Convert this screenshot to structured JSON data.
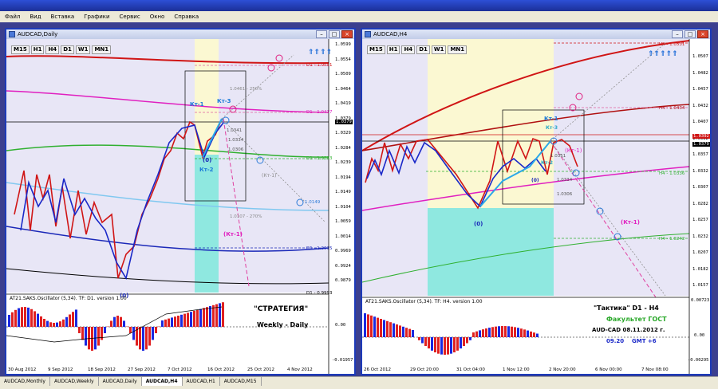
{
  "menu": [
    "Файл",
    "Вид",
    "Вставка",
    "Графики",
    "Сервис",
    "Окно",
    "Справка"
  ],
  "timeframes": [
    "M15",
    "H1",
    "H4",
    "D1",
    "W1",
    "MN1"
  ],
  "left_chart": {
    "title": "AUDCAD,Daily",
    "prices": [
      "1.0599",
      "1.0554",
      "1.0509",
      "1.0464",
      "1.0419",
      "1.0379",
      "1.0329",
      "1.0284",
      "1.0239",
      "1.0194",
      "1.0149",
      "1.0104",
      "1.0059",
      "1.0014",
      "0.9969",
      "0.9924",
      "0.9879"
    ],
    "current_price": "1.0379",
    "levels": {
      "d1_1": "D1 - 1.0551",
      "d1_2": "D1 - 1.0417",
      "d1_3": "D1 - 1.0283",
      "d1_4": "D1 - 1.0015",
      "d1_5": "D1 - 0.9993",
      "fib_250": "1.0461 - 250%",
      "fib_270": "1.0107 - 270%",
      "p1": "1.0341",
      "p2": "1.0334",
      "p3": "1.0306",
      "c1": "1.0149"
    },
    "annotations": {
      "kt1": "Кт-1",
      "kt3": "Кт-3",
      "kt2": "Кт-2",
      "zero": "(0)",
      "zero_low": "(0)",
      "kt1_neg": "(Кт-1)",
      "kt1_neg_small": "(Кт-1)"
    },
    "osc_label": "AT21.SAKS.Oscillator (5,34). TF: D1. version 1.00",
    "osc_values": [
      "0.00",
      "-0.01957"
    ],
    "dates": [
      "30 Aug 2012",
      "9 Sep 2012",
      "18 Sep 2012",
      "27 Sep 2012",
      "7 Oct 2012",
      "16 Oct 2012",
      "25 Oct 2012",
      "4 Nov 2012"
    ],
    "strategy": "\"СТРАТЕГИЯ\"",
    "strategy_sub": "Weekly - Daily"
  },
  "right_chart": {
    "title": "AUDCAD,H4",
    "prices": [
      "1.0507",
      "1.0482",
      "1.0457",
      "1.0432",
      "1.0407",
      "1.0382",
      "1.0357",
      "1.0332",
      "1.0307",
      "1.0282",
      "1.0257",
      "1.0232",
      "1.0207",
      "1.0182",
      "1.0157"
    ],
    "current_price": "1.0379",
    "price_red": "1.0392",
    "levels": {
      "h4_1": "H4 - 1.0531",
      "h4_2": "H4 - 1.0434",
      "h4_3": "H4 - 1.0336",
      "h4_4": "H4 - 1.0242",
      "p1": "1.0351",
      "p2": "1.0334",
      "p3": "1.0306"
    },
    "annotations": {
      "kt1": "Кт-1",
      "kt3": "Кт-3",
      "kt2": "Кт-2",
      "kt1_neg": "(Кт-1)",
      "kt1_neg2": "(Кт-1)",
      "zero": "(0)",
      "zero_low": "(0)"
    },
    "osc_label": "AT21.SAKS.Oscillator (5,34). TF: H4. version 1.00",
    "osc_values": [
      "0.00723",
      "0.00",
      "-0.00295"
    ],
    "dates": [
      "26 Oct 2012",
      "29 Oct 20:00",
      "31 Oct 04:00",
      "1 Nov 12:00",
      "2 Nov 20:00",
      "6 Nov 00:00",
      "7 Nov 08:00"
    ],
    "tactic": "\"Тактика\"  D1 - H4",
    "faculty": "Факультет ГОСТ",
    "pair_date": "AUD-CAD   08.11.2012  г.",
    "time": "09.20",
    "gmt": "GMT +6"
  },
  "tabs": [
    "AUDCAD,Monthly",
    "AUDCAD,Weekly",
    "AUDCAD,Daily",
    "AUDCAD,H4",
    "AUDCAD,H1",
    "AUDCAD,M15"
  ],
  "active_tab": "AUDCAD,H4"
}
